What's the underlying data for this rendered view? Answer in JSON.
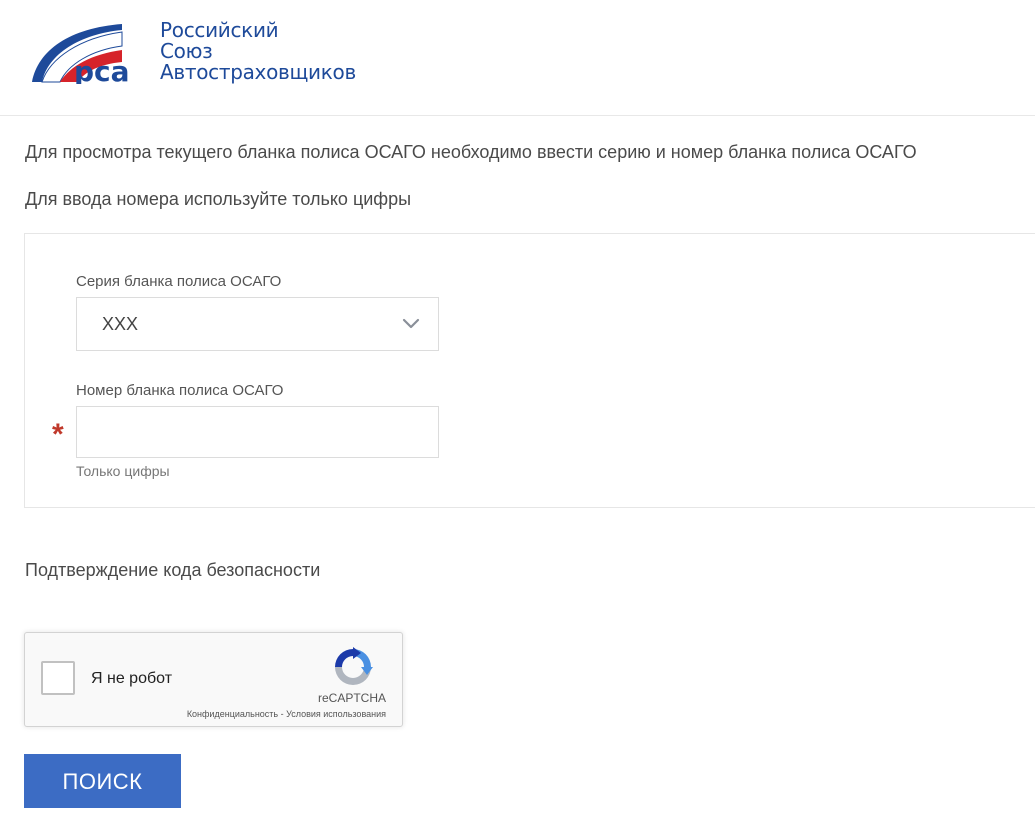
{
  "header": {
    "logo": {
      "mark_text": "рса",
      "lines": [
        "Российский",
        "Союз",
        "Автостраховщиков"
      ]
    }
  },
  "intro": {
    "line1": "Для просмотра текущего бланка полиса ОСАГО необходимо ввести серию и номер бланка полиса ОСАГО",
    "line2": "Для ввода номера используйте только цифры"
  },
  "form": {
    "series": {
      "label": "Серия бланка полиса ОСАГО",
      "selected_value": "ХХХ"
    },
    "number": {
      "label": "Номер бланка полиса ОСАГО",
      "value": "",
      "required_mark": "*",
      "hint": "Только цифры"
    }
  },
  "security": {
    "title": "Подтверждение кода безопасности",
    "captcha": {
      "label": "Я не робот",
      "checked": false,
      "brand": "reCAPTCHA",
      "links": "Конфиденциальность - Условия использования"
    }
  },
  "actions": {
    "search_label": "ПОИСК"
  },
  "colors": {
    "brand_blue": "#1e4a9a",
    "brand_red": "#d6232a",
    "button_blue": "#3c6cc4",
    "required_red": "#c0392b"
  }
}
